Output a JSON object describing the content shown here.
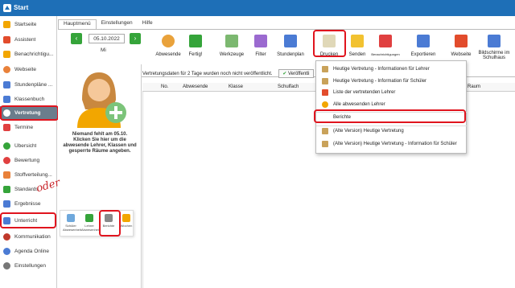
{
  "app": {
    "title": "Start"
  },
  "sidebar": {
    "items": [
      {
        "label": "Startseite",
        "icon": "star-icon",
        "color": "#f2a600"
      },
      {
        "label": "Assistent",
        "icon": "wand-icon",
        "color": "#e24c2c"
      },
      {
        "label": "Benachrichtigu...",
        "icon": "mail-icon",
        "color": "#f2a600"
      },
      {
        "label": "Webseite",
        "icon": "globe-icon",
        "color": "#e9813a"
      },
      {
        "label": "Stundenpläne ...",
        "icon": "grid-icon",
        "color": "#4b7bd4"
      },
      {
        "label": "Klassenbuch",
        "icon": "book-icon",
        "color": "#4b7bd4"
      },
      {
        "label": "Vertretung",
        "icon": "person-icon",
        "color": "#ffffff"
      },
      {
        "label": "Termine",
        "icon": "calendar-icon",
        "color": "#e04040"
      },
      {
        "label": "Übersicht",
        "icon": "check-circle-icon",
        "color": "#35a43a"
      },
      {
        "label": "Bewertung",
        "icon": "star-badge-icon",
        "color": "#e04040"
      },
      {
        "label": "Stoffverteilung...",
        "icon": "list-icon",
        "color": "#e9813a"
      },
      {
        "label": "Standards",
        "icon": "check-icon",
        "color": "#35a43a"
      },
      {
        "label": "Ergebnisse",
        "icon": "chart-icon",
        "color": "#4b7bd4"
      },
      {
        "label": "Unterricht",
        "icon": "school-icon",
        "color": "#4b7bd4"
      },
      {
        "label": "Kommunikation",
        "icon": "chat-icon",
        "color": "#c0392b"
      },
      {
        "label": "Agenda Online",
        "icon": "agenda-icon",
        "color": "#4b7bd4"
      },
      {
        "label": "Einstellungen",
        "icon": "gear-icon",
        "color": "#777777"
      }
    ]
  },
  "tabs": [
    {
      "label": "Hauptmenü"
    },
    {
      "label": "Einstellungen"
    },
    {
      "label": "Hilfe"
    }
  ],
  "date": {
    "value": "05.10.2022",
    "day": "Mi"
  },
  "ribbon": {
    "buttons": [
      {
        "label": "Abwesende",
        "icon": "person-icon",
        "dropdown": true
      },
      {
        "label": "Fertig!",
        "icon": "check-icon",
        "dropdown": false
      },
      {
        "label": "Werkzeuge",
        "icon": "tools-icon",
        "dropdown": true
      },
      {
        "label": "Filter",
        "icon": "filter-icon",
        "dropdown": true
      },
      {
        "label": "Stundenplan",
        "icon": "timetable-icon",
        "dropdown": true
      },
      {
        "label": "Drucken",
        "icon": "print-icon",
        "dropdown": true
      },
      {
        "label": "Senden",
        "icon": "envelope-icon",
        "dropdown": true
      },
      {
        "label": "Benachrichtigungen",
        "icon": "notification-icon",
        "dropdown": false
      },
      {
        "label": "Exportieren",
        "icon": "export-icon",
        "dropdown": true
      },
      {
        "label": "Webseite",
        "icon": "home-icon",
        "dropdown": false
      },
      {
        "label": "Bildschirme im Schulhaus",
        "icon": "monitor-icon",
        "dropdown": false
      }
    ]
  },
  "status": {
    "text": "Vertretungsdaten für 2 Tage wurden noch nicht veröffentlicht.",
    "button": "Veröffentli"
  },
  "grid": {
    "columns": [
      "No.",
      "Abwesende",
      "Klasse",
      "Schulfach",
      "Raum"
    ]
  },
  "left_panel": {
    "message_title": "Niemand fehlt am 05.10.",
    "message_body": "Klicken Sie hier um die abwesende Lehrer, Klassen und gesperrte Räume angeben."
  },
  "print_menu": {
    "items": [
      {
        "label": "Heutige Vertretung - Informationen für Lehrer",
        "icon": "doc-icon"
      },
      {
        "label": "Heutige Vertretung - Information für Schüler",
        "icon": "doc-icon"
      },
      {
        "label": "Liste der vertretenden Lehrer",
        "icon": "pin-icon"
      },
      {
        "label": "Alle abwesenden Lehrer",
        "icon": "person-icon"
      },
      {
        "label": "Berichte",
        "icon": "none"
      },
      {
        "label": "(Alte Version) Heutige Vertretung",
        "icon": "doc-icon"
      },
      {
        "label": "(Alte Version) Heutige Vertretung - Information für Schüler",
        "icon": "doc-icon"
      }
    ]
  },
  "annotation": {
    "oder": "oder"
  },
  "mini_toolbar": {
    "buttons": [
      {
        "label": "Schüler Abwesenheit"
      },
      {
        "label": "Lehrer Abwesenheit"
      },
      {
        "label": "Berichte"
      },
      {
        "label": "Wochen"
      }
    ]
  },
  "colors": {
    "accent": "#1e6fb7",
    "highlight": "#e0141e",
    "green": "#35a43a"
  }
}
